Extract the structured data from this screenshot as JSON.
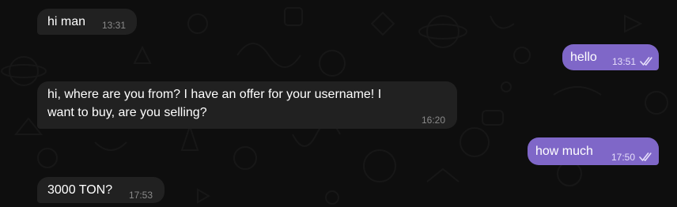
{
  "messages": [
    {
      "direction": "incoming",
      "text": "hi man",
      "time": "13:31"
    },
    {
      "direction": "outgoing",
      "text": "hello",
      "time": "13:51",
      "status": "read-double-check-icon"
    },
    {
      "direction": "incoming",
      "text_lines": [
        "hi, where are you from? I have an offer for your username! I",
        "want to buy, are you selling?"
      ],
      "time": "16:20"
    },
    {
      "direction": "outgoing",
      "text": "how much",
      "time": "17:50",
      "status": "read-double-check-icon"
    },
    {
      "direction": "incoming",
      "text": "3000 TON?",
      "time": "17:53"
    }
  ],
  "colors": {
    "background": "#0e0e0e",
    "incoming_bubble": "#212121",
    "outgoing_bubble": "#7f67c8",
    "pattern_stroke": "#1f1f1f"
  }
}
